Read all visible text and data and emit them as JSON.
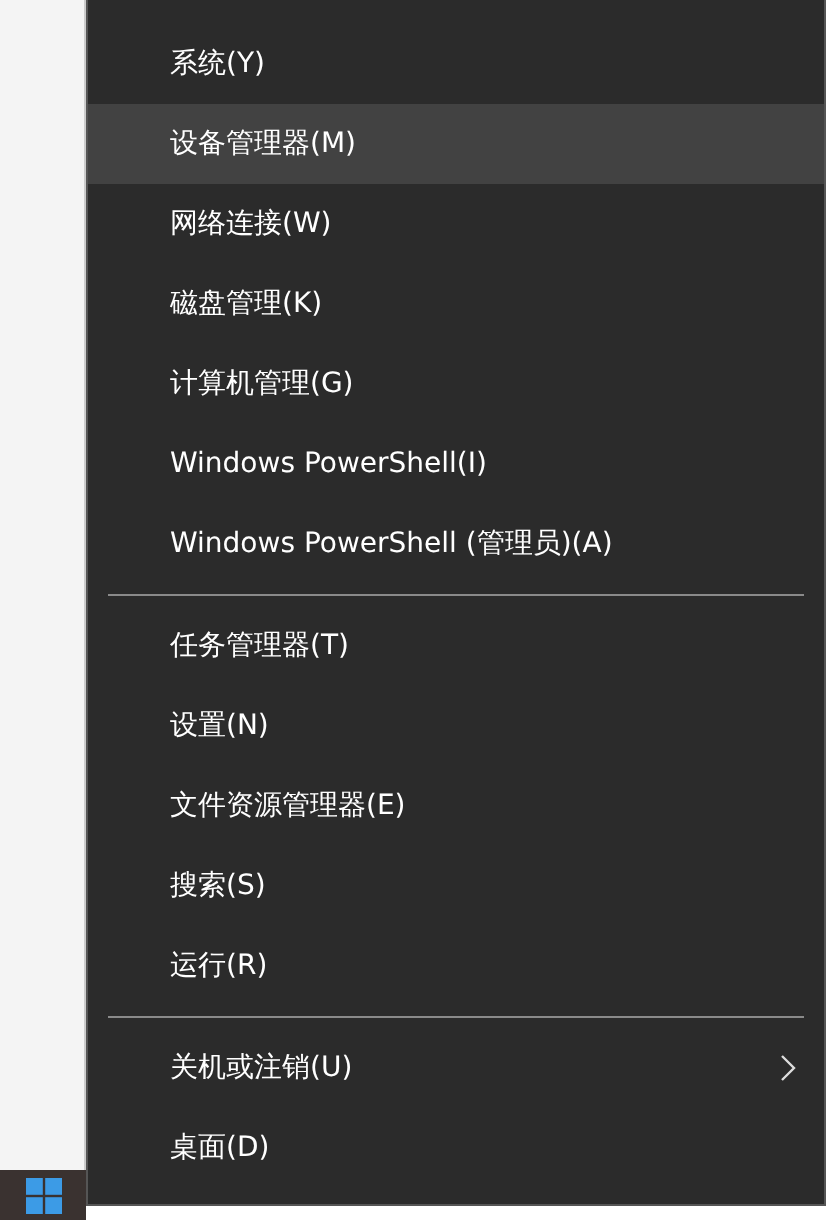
{
  "menu": {
    "sections": [
      {
        "items": [
          {
            "label": "系统(Y)",
            "selected": false
          },
          {
            "label": "设备管理器(M)",
            "selected": true
          },
          {
            "label": "网络连接(W)",
            "selected": false
          },
          {
            "label": "磁盘管理(K)",
            "selected": false
          },
          {
            "label": "计算机管理(G)",
            "selected": false
          },
          {
            "label": "Windows PowerShell(I)",
            "selected": false
          },
          {
            "label": "Windows PowerShell (管理员)(A)",
            "selected": false
          }
        ]
      },
      {
        "items": [
          {
            "label": "任务管理器(T)",
            "selected": false
          },
          {
            "label": "设置(N)",
            "selected": false
          },
          {
            "label": "文件资源管理器(E)",
            "selected": false
          },
          {
            "label": "搜索(S)",
            "selected": false
          },
          {
            "label": "运行(R)",
            "selected": false
          }
        ]
      },
      {
        "items": [
          {
            "label": "关机或注销(U)",
            "selected": false,
            "submenu": true
          },
          {
            "label": "桌面(D)",
            "selected": false
          }
        ]
      }
    ]
  }
}
